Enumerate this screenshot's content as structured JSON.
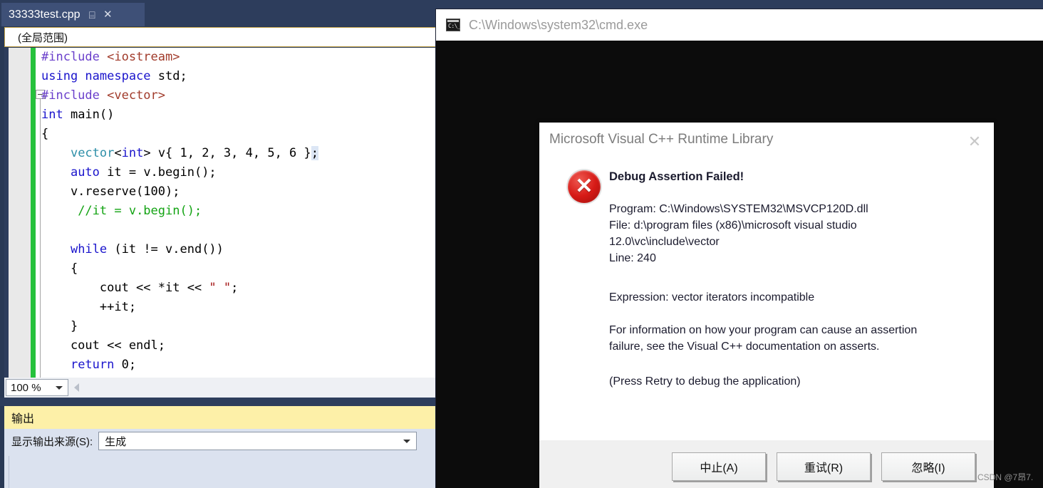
{
  "vs": {
    "tab": {
      "label": "33333test.cpp",
      "pin_icon": "pin-icon",
      "close_icon": "close-icon"
    },
    "scope_bar": {
      "value": "(全局范围)"
    },
    "code_lines": [
      [
        {
          "t": "#include ",
          "c": "pp"
        },
        {
          "t": "<iostream>",
          "c": "inc"
        }
      ],
      [
        {
          "t": "using namespace",
          "c": "kw"
        },
        {
          "t": " std;",
          "c": ""
        }
      ],
      [
        {
          "t": "#include ",
          "c": "pp"
        },
        {
          "t": "<vector>",
          "c": "inc"
        }
      ],
      [
        {
          "t": "int",
          "c": "kw"
        },
        {
          "t": " main()",
          "c": ""
        }
      ],
      [
        {
          "t": "{",
          "c": ""
        }
      ],
      [
        {
          "t": "    ",
          "c": ""
        },
        {
          "t": "vector",
          "c": "type"
        },
        {
          "t": "<",
          "c": ""
        },
        {
          "t": "int",
          "c": "kw"
        },
        {
          "t": "> v{ 1, 2, 3, 4, 5, 6 }",
          "c": ""
        },
        {
          "t": ";",
          "c": "sel"
        }
      ],
      [
        {
          "t": "    ",
          "c": ""
        },
        {
          "t": "auto",
          "c": "kw"
        },
        {
          "t": " it = v.begin();",
          "c": ""
        }
      ],
      [
        {
          "t": "    v.reserve(100);",
          "c": ""
        }
      ],
      [
        {
          "t": "     ",
          "c": ""
        },
        {
          "t": "//it = v.begin();",
          "c": "cm"
        }
      ],
      [
        {
          "t": "",
          "c": ""
        }
      ],
      [
        {
          "t": "    ",
          "c": ""
        },
        {
          "t": "while",
          "c": "kw"
        },
        {
          "t": " (it != v.end())",
          "c": ""
        }
      ],
      [
        {
          "t": "    {",
          "c": ""
        }
      ],
      [
        {
          "t": "        cout << *it << ",
          "c": ""
        },
        {
          "t": "\" \"",
          "c": "str"
        },
        {
          "t": ";",
          "c": ""
        }
      ],
      [
        {
          "t": "        ++it;",
          "c": ""
        }
      ],
      [
        {
          "t": "    }",
          "c": ""
        }
      ],
      [
        {
          "t": "    cout << endl;",
          "c": ""
        }
      ],
      [
        {
          "t": "    ",
          "c": ""
        },
        {
          "t": "return",
          "c": "kw"
        },
        {
          "t": " 0;",
          "c": ""
        }
      ]
    ],
    "zoom": {
      "value": "100 %",
      "caret_icon": "chevron-down-icon"
    },
    "hscroll_left_icon": "scroll-left-icon",
    "output": {
      "title": "输出",
      "source_label": "显示输出来源(S):",
      "source_value": "生成",
      "source_caret_icon": "chevron-down-icon"
    }
  },
  "cmd": {
    "title": "C:\\Windows\\system32\\cmd.exe",
    "icon": "cmd-icon",
    "icon_text": "C:\\_"
  },
  "dialog": {
    "title": "Microsoft Visual C++ Runtime Library",
    "close_icon": "close-icon",
    "error_icon": "error-circle-icon",
    "error_icon_glyph": "✕",
    "heading": "Debug Assertion Failed!",
    "details": "Program: C:\\Windows\\SYSTEM32\\MSVCP120D.dll\nFile: d:\\program files (x86)\\microsoft visual studio\n12.0\\vc\\include\\vector\nLine: 240",
    "expression": "Expression: vector iterators incompatible",
    "info": "For information on how your program can cause an assertion\nfailure, see the Visual C++ documentation on asserts.",
    "hint": "(Press Retry to debug the application)",
    "buttons": {
      "abort": "中止(A)",
      "retry": "重试(R)",
      "ignore": "忽略(I)"
    }
  },
  "watermark": "CSDN @7昂7."
}
